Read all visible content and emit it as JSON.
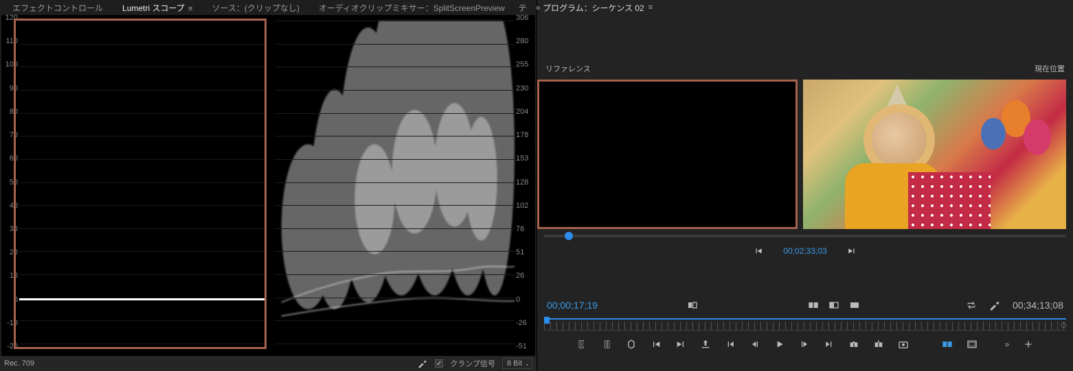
{
  "left_panel": {
    "tabs": {
      "effect_controls": "エフェクトコントロール",
      "lumetri_scopes": "Lumetri スコープ",
      "source": "ソース：(クリップなし)",
      "audio_mixer": "オーディオクリップミキサー：SplitScreenPreview",
      "overflow": "テ"
    },
    "left_axis_ticks": [
      "120",
      "110",
      "100",
      "90",
      "80",
      "70",
      "60",
      "50",
      "40",
      "30",
      "20",
      "10",
      "0",
      "-10",
      "-20"
    ],
    "right_axis_ticks": [
      "306",
      "280",
      "255",
      "230",
      "204",
      "178",
      "153",
      "128",
      "102",
      "76",
      "51",
      "26",
      "0",
      "-26",
      "-51"
    ],
    "footer": {
      "colorspace": "Rec. 709",
      "clamp_signal_label": "クランプ信号",
      "bit_depth": "8 Bit"
    }
  },
  "right_panel": {
    "title_prefix": "プログラム：",
    "sequence_name": "シーケンス 02",
    "reference_label": "リファレンス",
    "current_position_label": "現在位置",
    "ref_timecode": "00;02;33;03",
    "current_timecode": "00;00;17;19",
    "duration_timecode": "00;34;13;08"
  }
}
